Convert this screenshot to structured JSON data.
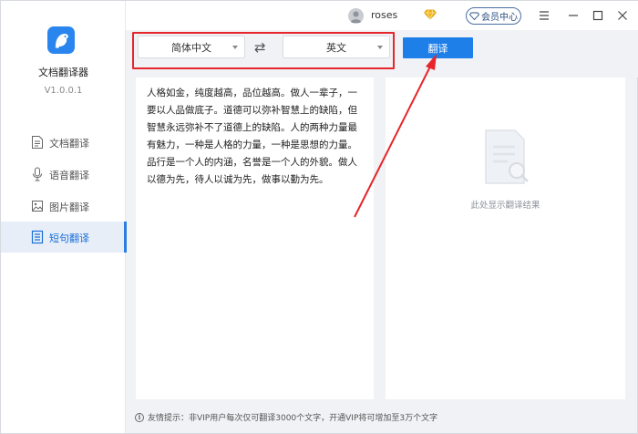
{
  "app": {
    "name": "文档翻译器",
    "version": "V1.0.0.1",
    "icon": "bird-logo-icon"
  },
  "sidebar": {
    "items": [
      {
        "label": "文档翻译",
        "icon": "document-icon",
        "active": false
      },
      {
        "label": "语音翻译",
        "icon": "microphone-icon",
        "active": false
      },
      {
        "label": "图片翻译",
        "icon": "image-icon",
        "active": false
      },
      {
        "label": "短句翻译",
        "icon": "text-list-icon",
        "active": true
      }
    ]
  },
  "titlebar": {
    "username": "roses",
    "vip_label": "会员中心",
    "controls": [
      "menu-icon",
      "minimize-icon",
      "maximize-icon",
      "close-icon"
    ]
  },
  "toolbar": {
    "source_language": "简体中文",
    "target_language": "英文",
    "swap_icon": "swap-icon",
    "translate_label": "翻译"
  },
  "source": {
    "text": "人格如金，纯度越高，品位越高。做人一辈子，一要以人品做底子。道德可以弥补智慧上的缺陷，但智慧永远弥补不了道德上的缺陷。人的两种力量最有魅力，一种是人格的力量，一种是思想的力量。品行是一个人的内涵，名誉是一个人的外貌。做人以德为先，待人以诚为先，做事以勤为先。"
  },
  "result": {
    "placeholder": "此处显示翻译结果"
  },
  "footer": {
    "tip": "友情提示：非VIP用户每次仅可翻译3000个文字，开通VIP将可增加至3万个文字"
  },
  "colors": {
    "accent": "#1f7fe8",
    "annotation_red": "#e6262c",
    "sidebar_active_bg": "#e7eef8",
    "window_bg": "#f0f2f5"
  }
}
